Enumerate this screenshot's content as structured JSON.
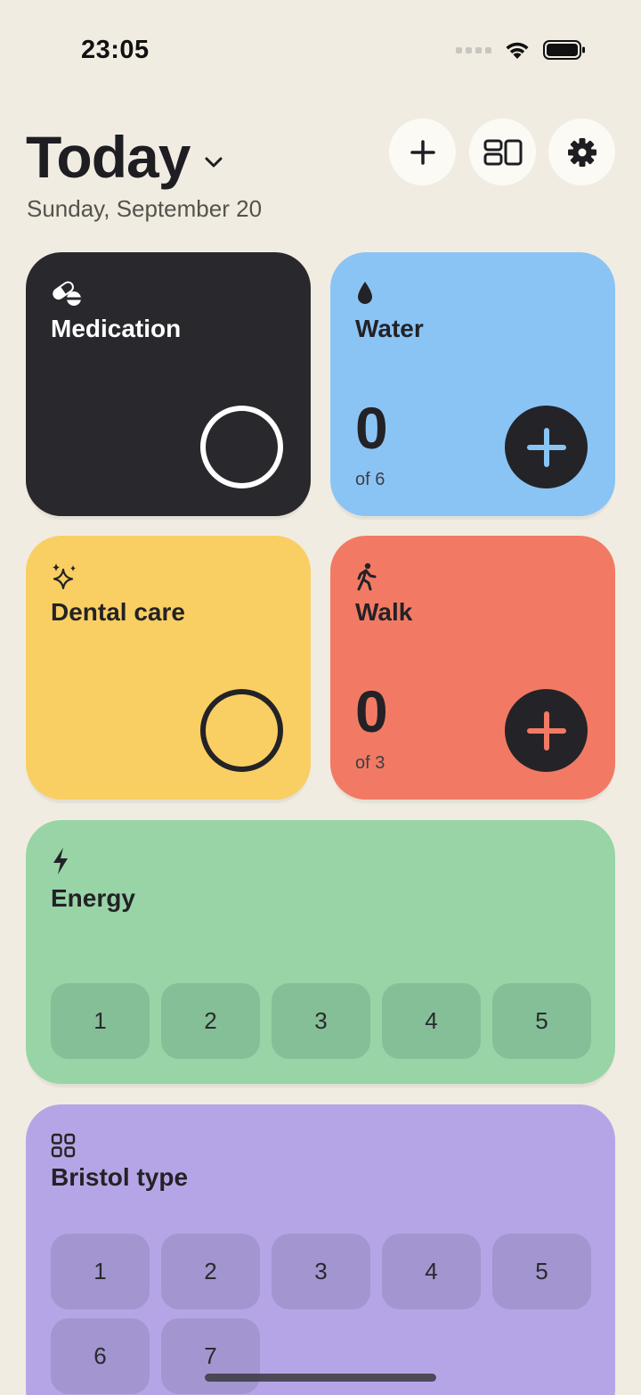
{
  "status_bar": {
    "time": "23:05"
  },
  "header": {
    "title": "Today",
    "date": "Sunday, September 20"
  },
  "icons": {
    "add": "plus-icon",
    "layout": "layout-icon",
    "settings": "gear-icon",
    "title_dropdown": "chevron-down-icon"
  },
  "cards": {
    "medication": {
      "title": "Medication",
      "icon": "pills-icon",
      "color": "#29292D"
    },
    "water": {
      "title": "Water",
      "icon": "drop-icon",
      "value": "0",
      "of_text": "of 6",
      "color": "#8AC4F5"
    },
    "dental": {
      "title": "Dental care",
      "icon": "sparkles-icon",
      "color": "#F9CF63"
    },
    "walk": {
      "title": "Walk",
      "icon": "walking-person-icon",
      "value": "0",
      "of_text": "of 3",
      "color": "#F27A64"
    },
    "energy": {
      "title": "Energy",
      "icon": "lightning-icon",
      "color": "#98D4A6",
      "options": [
        "1",
        "2",
        "3",
        "4",
        "5"
      ]
    },
    "bristol": {
      "title": "Bristol type",
      "icon": "grid-icon",
      "color": "#B6A5E6",
      "options_row1": [
        "1",
        "2",
        "3",
        "4",
        "5"
      ],
      "options_row2": [
        "6",
        "7"
      ]
    }
  }
}
